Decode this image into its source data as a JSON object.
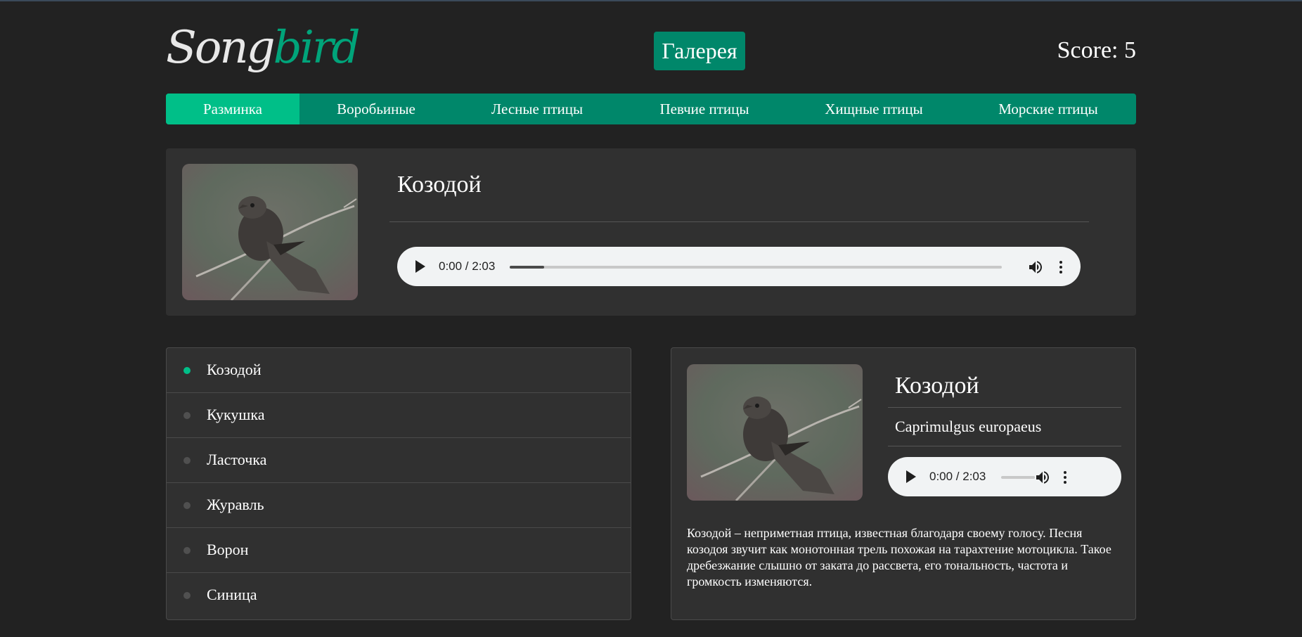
{
  "header": {
    "logo_part1": "Song",
    "logo_part2": "bird",
    "gallery_label": "Галерея",
    "score_text": "Score: 5"
  },
  "nav": {
    "items": [
      {
        "label": "Разминка",
        "active": true
      },
      {
        "label": "Воробьиные",
        "active": false
      },
      {
        "label": "Лесные птицы",
        "active": false
      },
      {
        "label": "Певчие птицы",
        "active": false
      },
      {
        "label": "Хищные птицы",
        "active": false
      },
      {
        "label": "Морские птицы",
        "active": false
      }
    ]
  },
  "question": {
    "bird_name": "Козодой",
    "player": {
      "time": "0:00 / 2:03",
      "progress": 0.07
    }
  },
  "answers": [
    {
      "label": "Козодой",
      "selected": true
    },
    {
      "label": "Кукушка",
      "selected": false
    },
    {
      "label": "Ласточка",
      "selected": false
    },
    {
      "label": "Журавль",
      "selected": false
    },
    {
      "label": "Ворон",
      "selected": false
    },
    {
      "label": "Синица",
      "selected": false
    }
  ],
  "details": {
    "bird_name": "Козодой",
    "latin_name": "Caprimulgus europaeus",
    "player": {
      "time": "0:00 / 2:03",
      "progress": 0
    },
    "description": "Козодой – неприметная птица, известная благодаря своему голосу. Песня козодоя звучит как монотонная трель похожая на тарахтение мотоцикла. Такое дребезжание слышно от заката до рассвета, его тональность, частота и громкость изменяются."
  },
  "colors": {
    "background": "#222222",
    "panel": "#303030",
    "accent": "#00876a",
    "accent_active": "#00bf88"
  }
}
